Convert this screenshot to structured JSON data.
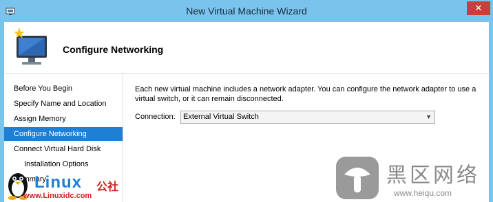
{
  "window": {
    "title": "New Virtual Machine Wizard",
    "close_glyph": "✕"
  },
  "header": {
    "heading": "Configure Networking"
  },
  "sidebar": {
    "items": [
      {
        "label": "Before You Begin",
        "active": false
      },
      {
        "label": "Specify Name and Location",
        "active": false
      },
      {
        "label": "Assign Memory",
        "active": false
      },
      {
        "label": "Configure Networking",
        "active": true
      },
      {
        "label": "Connect Virtual Hard Disk",
        "active": false
      },
      {
        "label": "Installation Options",
        "active": false,
        "sub": true
      },
      {
        "label": "Summary",
        "active": false
      }
    ]
  },
  "main": {
    "description": "Each new virtual machine includes a network adapter. You can configure the network adapter to use a virtual switch, or it can remain disconnected.",
    "connection_label": "Connection:",
    "connection_value": "External Virtual Switch"
  },
  "watermarks": {
    "left_brand": "Linux",
    "left_brand_cn": "公社",
    "left_url": "www.Linuxidc.com",
    "right_cn": "黑区网络",
    "right_url": "www.heiqu.com"
  },
  "colors": {
    "titlebar": "#79c3ec",
    "active_item": "#1e7fd4",
    "close_button": "#c7403a"
  }
}
